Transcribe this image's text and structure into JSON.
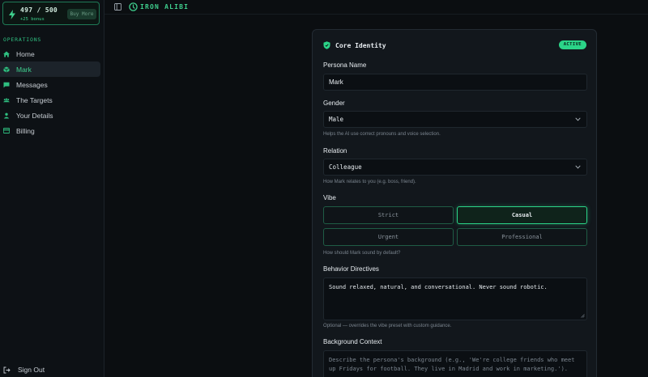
{
  "sidebar": {
    "credits": {
      "count": "497 / 500",
      "bonus": "+25 bonus",
      "buy_label": "Buy More"
    },
    "section_label": "OPERATIONS",
    "items": [
      {
        "label": "Home",
        "icon": "home-icon"
      },
      {
        "label": "Mark",
        "icon": "box-icon",
        "active": true
      },
      {
        "label": "Messages",
        "icon": "message-icon"
      },
      {
        "label": "The Targets",
        "icon": "users-icon"
      },
      {
        "label": "Your Details",
        "icon": "user-icon"
      },
      {
        "label": "Billing",
        "icon": "card-icon"
      }
    ],
    "sign_out": "Sign Out"
  },
  "topbar": {
    "logo_text": "IRON ALIBI"
  },
  "card": {
    "title": "Core Identity",
    "status": "ACTIVE",
    "persona_name": {
      "label": "Persona Name",
      "value": "Mark"
    },
    "gender": {
      "label": "Gender",
      "value": "Male",
      "hint": "Helps the AI use correct pronouns and voice selection."
    },
    "relation": {
      "label": "Relation",
      "value": "Colleague",
      "hint": "How Mark relates to you (e.g. boss, friend)."
    },
    "vibe": {
      "label": "Vibe",
      "options": [
        "Strict",
        "Casual",
        "Urgent",
        "Professional"
      ],
      "selected": "Casual",
      "hint": "How should Mark sound by default?"
    },
    "behavior": {
      "label": "Behavior Directives",
      "value": "Sound relaxed, natural, and conversational. Never sound robotic.",
      "hint": "Optional — overrides the vibe preset with custom guidance."
    },
    "background": {
      "label": "Background Context",
      "placeholder": "Describe the persona's background (e.g., 'We're college friends who meet up Fridays for football. They live in Madrid and work in marketing.')."
    }
  },
  "colors": {
    "accent": "#2bd488",
    "background": "#0b0e11",
    "card": "#12171c"
  }
}
